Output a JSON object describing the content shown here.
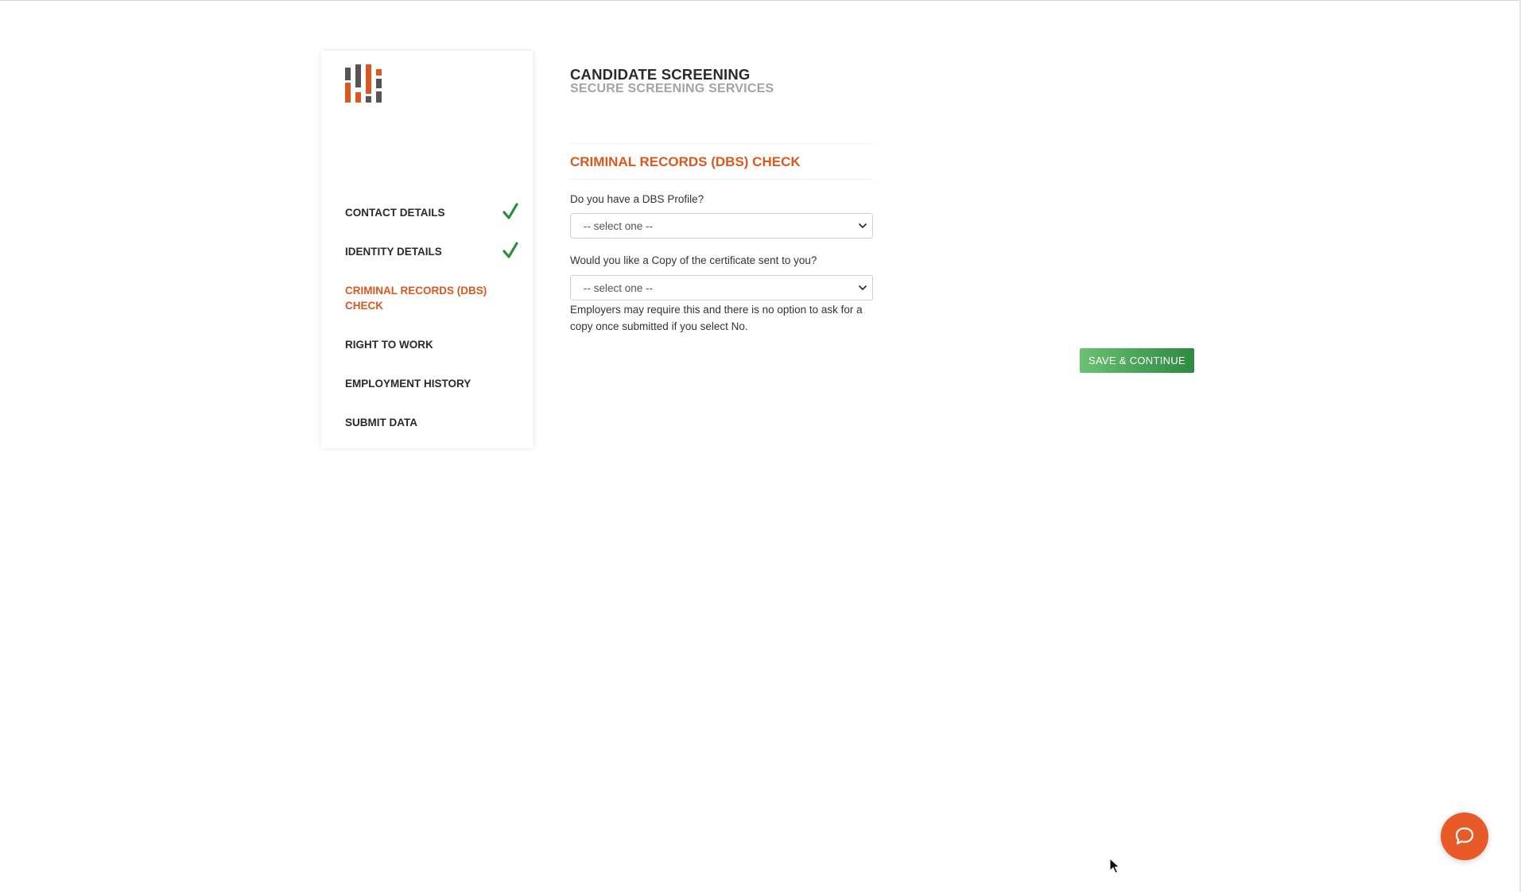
{
  "header": {
    "title": "CANDIDATE SCREENING",
    "subtitle": "SECURE SCREENING SERVICES"
  },
  "sidebar": {
    "items": [
      {
        "label": "CONTACT DETAILS",
        "completed": true
      },
      {
        "label": "IDENTITY DETAILS",
        "completed": true
      },
      {
        "label": "CRIMINAL RECORDS (DBS) CHECK",
        "active": true
      },
      {
        "label": "RIGHT TO WORK"
      },
      {
        "label": "EMPLOYMENT HISTORY"
      },
      {
        "label": "SUBMIT DATA"
      }
    ]
  },
  "section": {
    "title": "CRIMINAL RECORDS (DBS) CHECK"
  },
  "form": {
    "dbs_profile": {
      "label": "Do you have a DBS Profile?",
      "value": "-- select one --"
    },
    "certificate_copy": {
      "label": "Would you like a Copy of the certificate sent to you?",
      "value": "-- select one --",
      "help": "Employers may require this and there is no option to ask for a copy once submitted if you select No."
    }
  },
  "actions": {
    "save_label": "SAVE & CONTINUE"
  },
  "icons": {
    "logo": "logo-bars-icon",
    "check": "checkmark-icon",
    "chevron": "chevron-down-icon",
    "chat": "chat-bubble-icon"
  },
  "colors": {
    "accent": "#d9581f",
    "check": "#2e8b3a",
    "save_button": "#4aa45a",
    "chat_button": "#e85a28",
    "subtitle": "#a3a3a3"
  }
}
